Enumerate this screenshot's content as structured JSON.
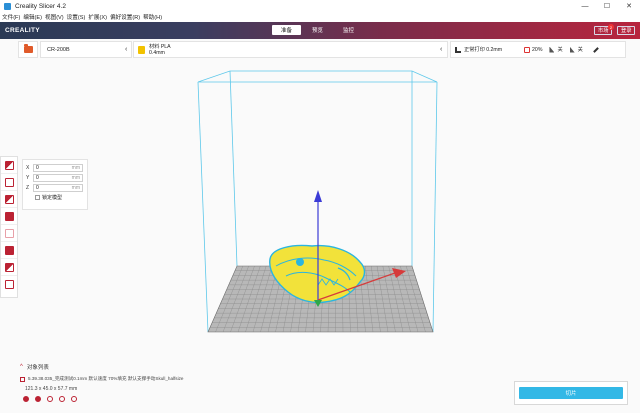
{
  "window": {
    "title": "Creality Slicer 4.2",
    "minimize": "—",
    "maximize": "☐",
    "close": "✕"
  },
  "menu": [
    "文件(F)",
    "编辑(E)",
    "视图(V)",
    "设置(S)",
    "扩展(X)",
    "偏好设置(R)",
    "帮助(H)"
  ],
  "header": {
    "logo": "CREALITY",
    "tabs": [
      "准备",
      "预览",
      "监控"
    ],
    "active_tab": 0,
    "market_label": "市场",
    "login_label": "登录",
    "badge": "2"
  },
  "toolbar": {
    "printer": "CR-200B",
    "material_name": "材料 PLA",
    "material_size": "0.4mm",
    "profile": "正常打印 0.2mm",
    "infill": "20%",
    "support": "关",
    "adhesion": "关"
  },
  "move_panel": {
    "x_label": "X",
    "x_value": "0",
    "y_label": "Y",
    "y_value": "0",
    "z_label": "Z",
    "z_value": "0",
    "unit": "mm",
    "lock_label": "锁定模型"
  },
  "object_list": {
    "title": "对象列表",
    "item": "5.39.38.035_完成测试0.1mm 默认速度 70%填充 默认支撑手动Skull_halfsize",
    "dimensions": "121.3 x 45.0 x 57.7 mm"
  },
  "slice": {
    "label": "切片"
  },
  "colors": {
    "accent": "#33b8e6",
    "brand_red": "#b8253e",
    "model": "#f2e23a",
    "outline": "#2bb5e0"
  }
}
